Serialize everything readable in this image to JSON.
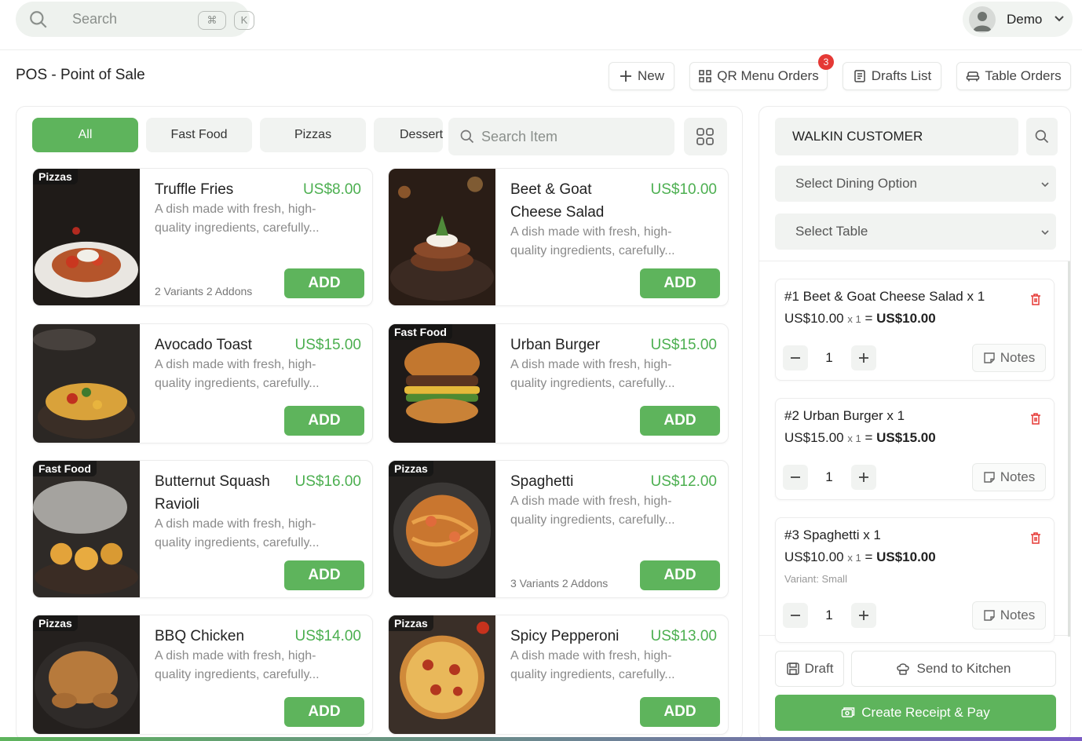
{
  "topbar": {
    "search_placeholder": "Search",
    "shortcut_cmd": "⌘",
    "shortcut_key": "K",
    "user_name": "Demo"
  },
  "header": {
    "title": "POS - Point of Sale",
    "new_label": "New",
    "qr_label": "QR Menu Orders",
    "qr_badge": "3",
    "drafts_label": "Drafts List",
    "table_label": "Table Orders"
  },
  "categories": [
    "All",
    "Fast Food",
    "Pizzas",
    "Desserts"
  ],
  "item_search_placeholder": "Search Item",
  "items": [
    {
      "name": "Truffle Fries",
      "price": "US$8.00",
      "tag": "Pizzas",
      "desc": "A dish made with fresh, high-quality ingredients, carefully...",
      "variants": "2 Variants 2 Addons",
      "add": "ADD"
    },
    {
      "name": "Beet & Goat Cheese Salad",
      "price": "US$10.00",
      "tag": "",
      "desc": "A dish made with fresh, high-quality ingredients, carefully...",
      "variants": "",
      "add": "ADD"
    },
    {
      "name": "Avocado Toast",
      "price": "US$15.00",
      "tag": "",
      "desc": "A dish made with fresh, high-quality ingredients, carefully...",
      "variants": "",
      "add": "ADD"
    },
    {
      "name": "Urban Burger",
      "price": "US$15.00",
      "tag": "Fast Food",
      "desc": "A dish made with fresh, high-quality ingredients, carefully...",
      "variants": "",
      "add": "ADD"
    },
    {
      "name": "Butternut Squash Ravioli",
      "price": "US$16.00",
      "tag": "Fast Food",
      "desc": "A dish made with fresh, high-quality ingredients, carefully...",
      "variants": "",
      "add": "ADD"
    },
    {
      "name": "Spaghetti",
      "price": "US$12.00",
      "tag": "Pizzas",
      "desc": "A dish made with fresh, high-quality ingredients, carefully...",
      "variants": "3 Variants 2 Addons",
      "add": "ADD"
    },
    {
      "name": "BBQ Chicken",
      "price": "US$14.00",
      "tag": "Pizzas",
      "desc": "A dish made with fresh, high-quality ingredients, carefully...",
      "variants": "",
      "add": "ADD"
    },
    {
      "name": "Spicy Pepperoni",
      "price": "US$13.00",
      "tag": "Pizzas",
      "desc": "A dish made with fresh, high-quality ingredients, carefully...",
      "variants": "",
      "add": "ADD"
    }
  ],
  "order": {
    "customer": "WALKIN CUSTOMER",
    "dining_option": "Select Dining Option",
    "table": "Select Table",
    "lines": [
      {
        "title": "#1 Beet & Goat Cheese Salad x 1",
        "unit": "US$10.00",
        "mult": "x 1",
        "eq": "=",
        "total": "US$10.00",
        "variant": "",
        "qty": "1",
        "notes": "Notes"
      },
      {
        "title": "#2 Urban Burger x 1",
        "unit": "US$15.00",
        "mult": "x 1",
        "eq": "=",
        "total": "US$15.00",
        "variant": "",
        "qty": "1",
        "notes": "Notes"
      },
      {
        "title": "#3 Spaghetti x 1",
        "unit": "US$10.00",
        "mult": "x 1",
        "eq": "=",
        "total": "US$10.00",
        "variant": "Variant: Small",
        "qty": "1",
        "notes": "Notes"
      }
    ],
    "draft_label": "Draft",
    "kitchen_label": "Send to Kitchen",
    "pay_label": "Create Receipt & Pay"
  },
  "colors": {
    "accent": "#5eb45c",
    "price": "#4caf50",
    "danger": "#e53935"
  }
}
